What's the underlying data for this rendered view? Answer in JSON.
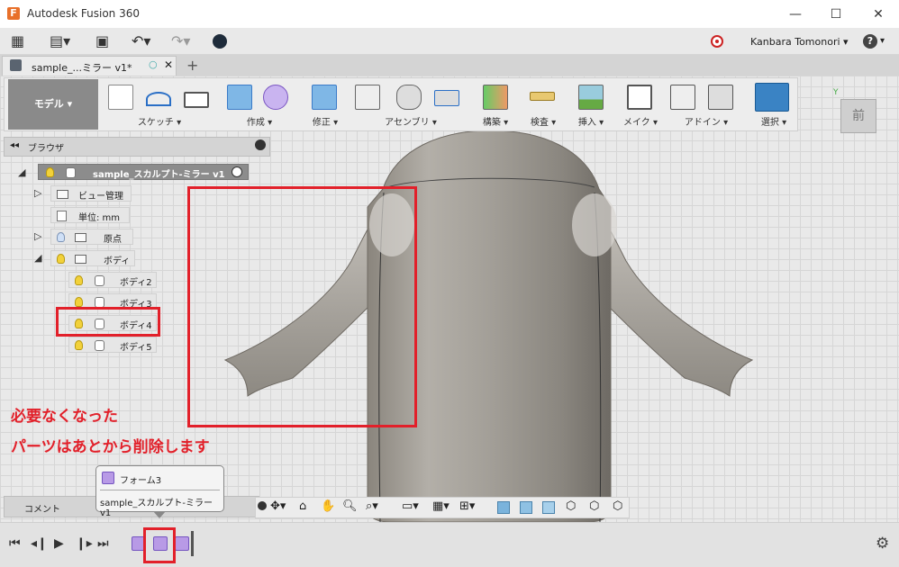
{
  "app": {
    "title": "Autodesk Fusion 360",
    "logo_letter": "F"
  },
  "window": {
    "minimize": "—",
    "maximize": "☐",
    "close": "✕"
  },
  "qat": {
    "user": "Kanbara Tomonori",
    "help": "?"
  },
  "doc_tab": {
    "title": "sample_...ミラー v1*"
  },
  "toolbar": {
    "workspace": "モデル",
    "groups": [
      {
        "label": "スケッチ ▾"
      },
      {
        "label": "作成 ▾"
      },
      {
        "label": "修正 ▾"
      },
      {
        "label": "アセンブリ ▾"
      },
      {
        "label": "構築 ▾"
      },
      {
        "label": "検査 ▾"
      },
      {
        "label": "挿入 ▾"
      },
      {
        "label": "メイク ▾"
      },
      {
        "label": "アドイン ▾"
      },
      {
        "label": "選択 ▾"
      }
    ]
  },
  "viewcube": {
    "face": "前"
  },
  "browser": {
    "title": "ブラウザ",
    "root": "sample_スカルプト-ミラー v1",
    "view_mgmt": "ビュー管理",
    "units": "単位: mm",
    "origin": "原点",
    "bodies": "ボディ",
    "body_items": [
      "ボディ2",
      "ボディ3",
      "ボディ4",
      "ボディ5"
    ]
  },
  "annotation": {
    "line1": "必要なくなった",
    "line2": "パーツはあとから削除します"
  },
  "comment": {
    "label": "コメント"
  },
  "tooltip": {
    "title": "フォーム3",
    "subtitle": "sample_スカルプト-ミラー v1"
  },
  "colors": {
    "highlight": "#e2202a",
    "form_icon": "#b89ae6",
    "model_gray": "#9a968f"
  }
}
